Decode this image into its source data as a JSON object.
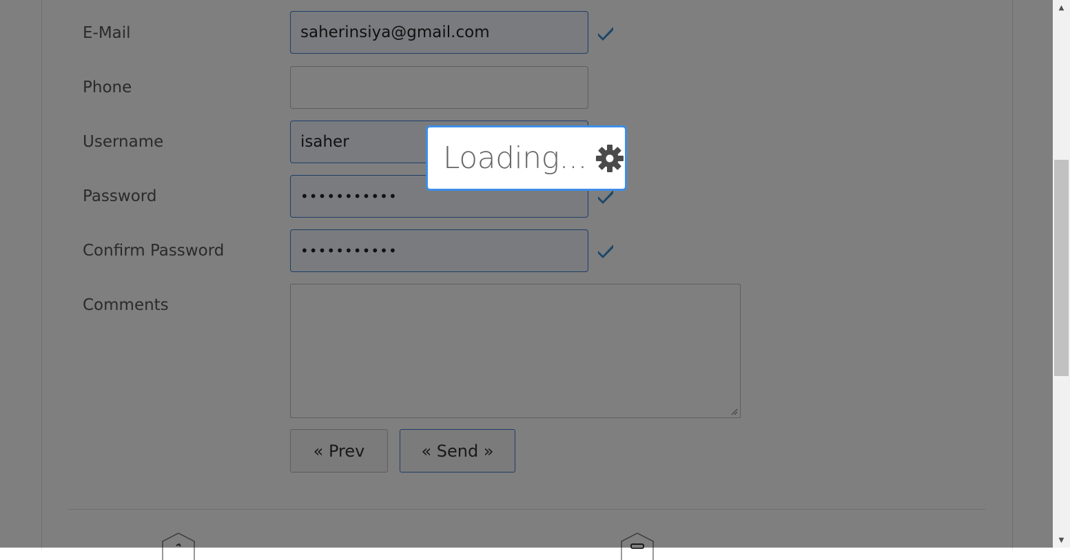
{
  "form": {
    "email_label": "E-Mail",
    "email_value": "saherinsiya@gmail.com",
    "phone_label": "Phone",
    "phone_value": "",
    "username_label": "Username",
    "username_value": "isaher",
    "password_label": "Password",
    "password_value": "•••••••••••",
    "confirm_password_label": "Confirm Password",
    "confirm_password_value": "•••••••••••",
    "comments_label": "Comments",
    "comments_value": ""
  },
  "buttons": {
    "prev_label": "« Prev",
    "send_label": "« Send »"
  },
  "loading": {
    "text": "Loading..."
  },
  "icons": {
    "valid": "check-icon",
    "loading": "gear-icon"
  },
  "colors": {
    "accent": "#3c7ad1",
    "check": "#3a8fd0",
    "loading_border": "#3d8ee8",
    "overlay": "rgba(0,0,0,0.5)"
  }
}
